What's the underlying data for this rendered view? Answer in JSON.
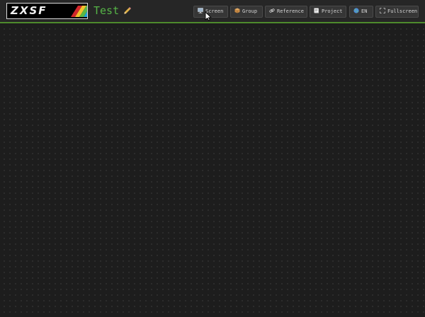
{
  "app": {
    "logo_text": "ZXSF",
    "project_title": "Test",
    "accent_color": "#56b447",
    "header_border_color": "#4e8a2c",
    "logo_stripe_colors": [
      "#d2272b",
      "#f2c12e",
      "#5bb744",
      "#1fa4db"
    ]
  },
  "toolbar": {
    "buttons": [
      {
        "label": "Screen",
        "icon": "monitor-icon"
      },
      {
        "label": "Group",
        "icon": "package-icon"
      },
      {
        "label": "Reference",
        "icon": "link-icon"
      },
      {
        "label": "Project",
        "icon": "folder-icon"
      },
      {
        "label": "EN",
        "icon": "globe-icon"
      },
      {
        "label": "Fullscreen",
        "icon": "expand-icon"
      }
    ]
  }
}
